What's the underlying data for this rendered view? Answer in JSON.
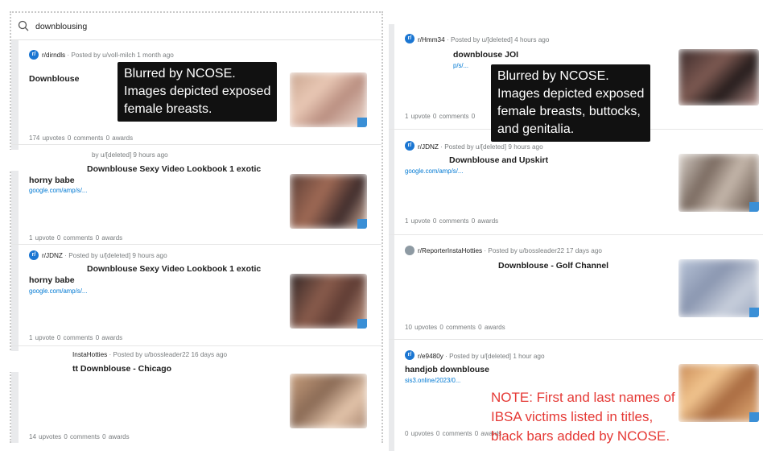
{
  "search": {
    "query": "downblousing"
  },
  "left_posts": [
    {
      "sub": "r/dirndls",
      "meta": " · Posted by u/voll-milch 1 month ago",
      "title": "Downblouse",
      "link": "",
      "stats": "174 upvotes   0 comments   0 awards"
    },
    {
      "sub": "",
      "meta": "by u/[deleted] 9 hours ago",
      "title": "Downblouse Sexy Video Lookbook 1 exotic",
      "title2": "horny babe",
      "link": "google.com/amp/s/...",
      "stats": "1 upvote   0 comments   0 awards"
    },
    {
      "sub": "r/JDNZ",
      "meta": " · Posted by u/[deleted] 9 hours ago",
      "title": "Downblouse Sexy Video Lookbook 1 exotic",
      "title2": "horny babe",
      "link": "google.com/amp/s/...",
      "stats": "1 upvote   0 comments   0 awards"
    },
    {
      "sub": "InstaHotties",
      "meta": " · Posted by u/bossleader22 16 days ago",
      "title": "tt Downblouse - Chicago",
      "link": "",
      "stats": "14 upvotes   0 comments   0 awards"
    }
  ],
  "right_posts": [
    {
      "sub": "r/Hmm34",
      "meta": " · Posted by u/[deleted] 4 hours ago",
      "title": "downblouse JOI",
      "link": "p/s/...",
      "stats": "1 upvote   0 comments   0"
    },
    {
      "sub": "r/JDNZ",
      "meta": " · Posted by u/[deleted] 9 hours ago",
      "title": "Downblouse and Upskirt",
      "link": "google.com/amp/s/...",
      "stats": "1 upvote   0 comments   0 awards"
    },
    {
      "sub": "r/ReporterInstaHotties",
      "meta": " · Posted by u/bossleader22 17 days ago",
      "title": "Downblouse - Golf Channel",
      "link": "",
      "stats": "10 upvotes   0 comments   0 awards"
    },
    {
      "sub": "r/e9480y",
      "meta": " · Posted by u/[deleted] 1 hour ago",
      "title": "handjob downblouse",
      "link": "sis3.online/2023/0...",
      "stats": "0 upvotes   0 comments   0 awards"
    }
  ],
  "annotations": {
    "box1": [
      "Blurred by NCOSE.",
      "Images depicted exposed",
      "female breasts."
    ],
    "box2": [
      "Blurred by NCOSE.",
      "Images depicted exposed",
      "female breasts, buttocks,",
      "and genitalia."
    ],
    "red_note": "NOTE: First and last names of IBSA victims listed in titles, black bars added by NCOSE."
  },
  "colors": {
    "link": "#0079d3",
    "icon_blue": "#1b76d2",
    "note_red": "#e53935",
    "meta_gray": "#787c7e"
  }
}
